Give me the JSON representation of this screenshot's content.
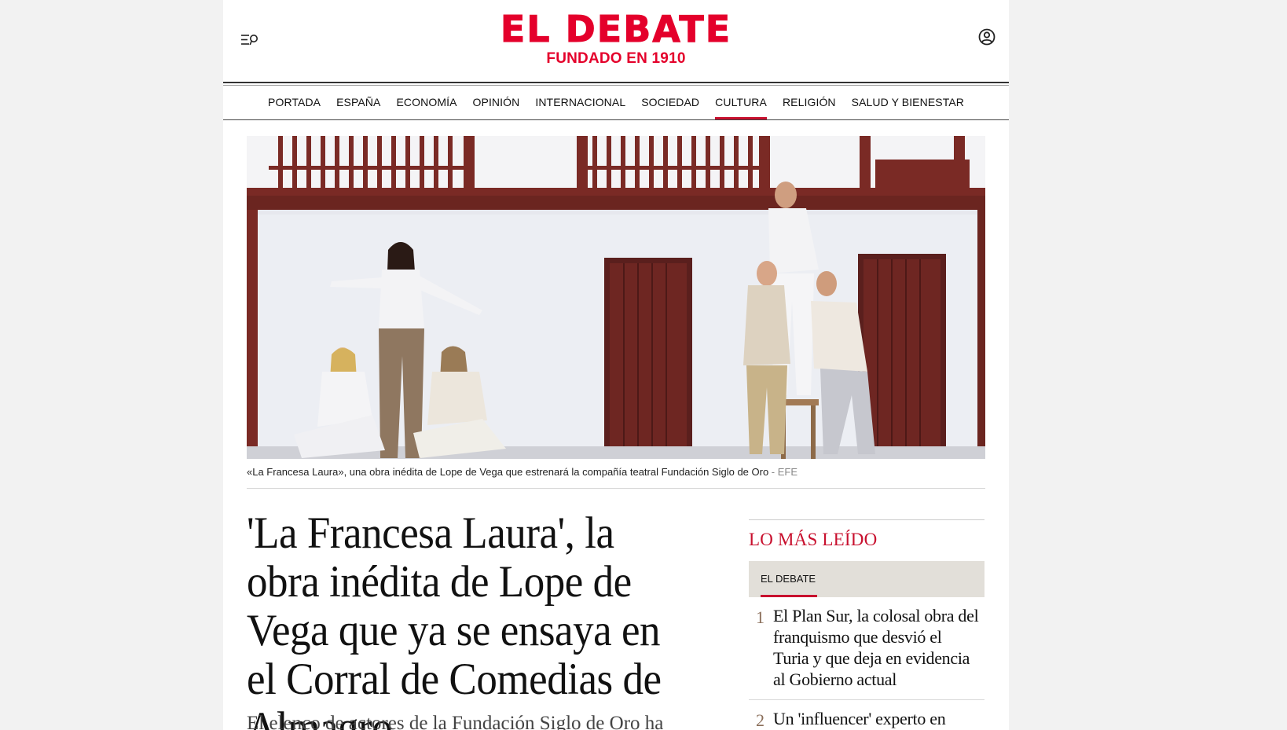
{
  "header": {
    "logo_title": "EL DEBATE",
    "logo_subtitle": "FUNDADO EN 1910",
    "colors": {
      "brand": "#e4002b",
      "accent": "#c8102e"
    },
    "menu_icon": "menu-search-icon",
    "user_icon": "user-circle-icon"
  },
  "nav": {
    "items": [
      {
        "label": "PORTADA"
      },
      {
        "label": "ESPAÑA"
      },
      {
        "label": "ECONOMÍA"
      },
      {
        "label": "OPINIÓN"
      },
      {
        "label": "INTERNACIONAL"
      },
      {
        "label": "SOCIEDAD"
      },
      {
        "label": "CULTURA"
      },
      {
        "label": "RELIGIÓN"
      },
      {
        "label": "SALUD Y BIENESTAR"
      }
    ],
    "active": "CULTURA"
  },
  "hero": {
    "caption": "«La Francesa Laura», una obra inédita de Lope de Vega que estrenará la compañía teatral Fundación Siglo de Oro",
    "credit": " - EFE"
  },
  "article": {
    "title": "'La Francesa Laura', la obra inédita de Lope de Vega que ya se ensaya en el Corral de Comedias de Almagro",
    "subtitle": "El elenco de actores de la Fundación Siglo de Oro ha"
  },
  "sidebar": {
    "title": "LO MÁS LEÍDO",
    "tab": "EL DEBATE",
    "items": [
      {
        "rank": "1",
        "text": "El Plan Sur, la colosal obra del franquismo que desvió el Turia y que deja en evidencia al Gobierno actual"
      },
      {
        "rank": "2",
        "text": "Un 'influencer' experto en física desvela de dónde"
      }
    ]
  }
}
